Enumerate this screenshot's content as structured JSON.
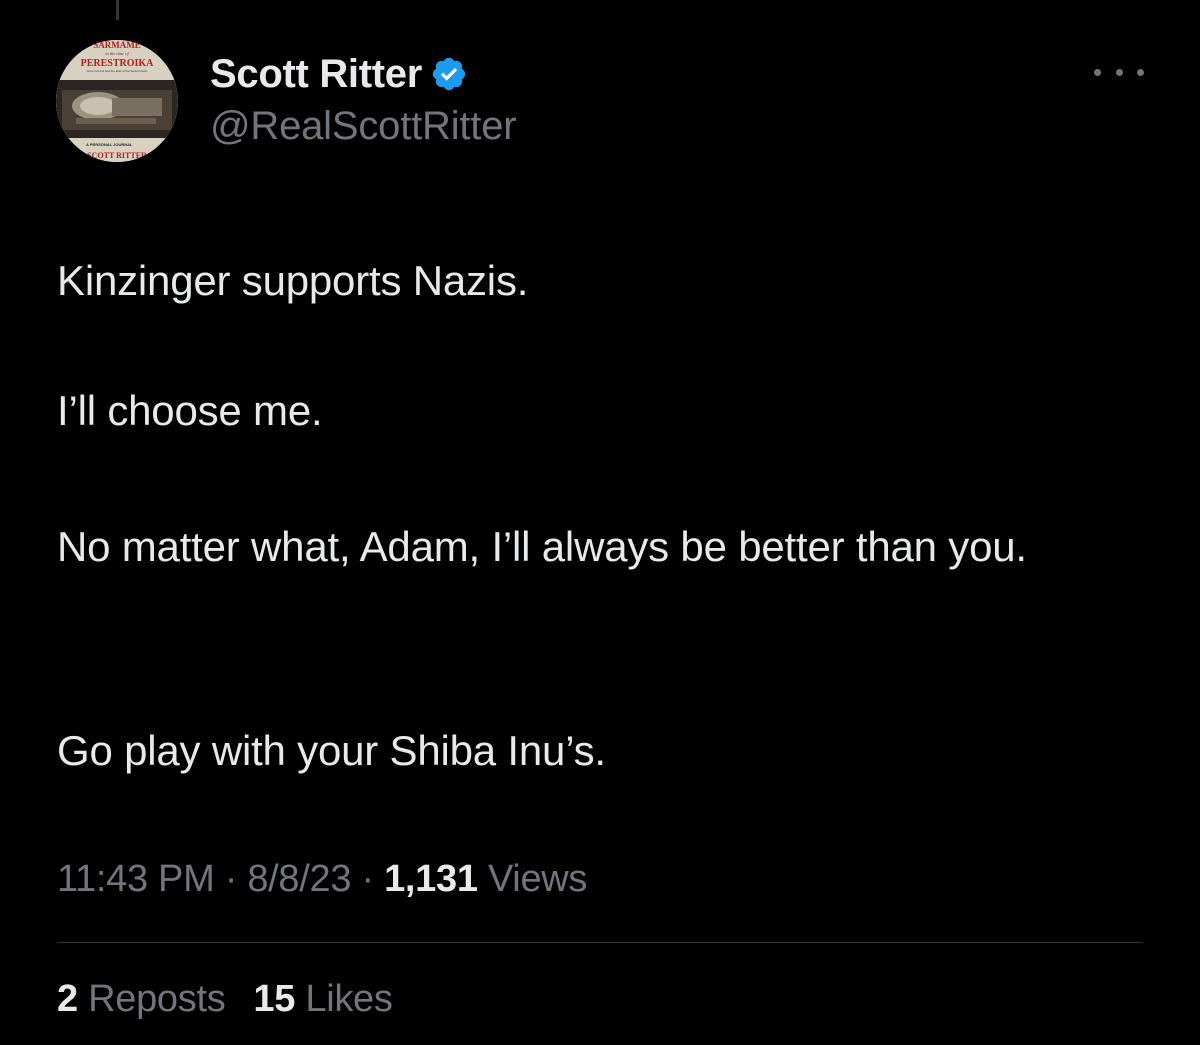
{
  "author": {
    "display_name": "Scott Ritter",
    "handle": "@RealScottRitter",
    "verified_icon": "verified-badge-icon",
    "avatar_text": {
      "title_top": "SARMAME",
      "subtitle": "in the time of",
      "title_main": "PERESTROIKA",
      "tagline": "Arms Control and the End of the Soviet Union",
      "journal": "A PERSONAL JOURNAL",
      "author_name": "SCOTT RITTER"
    }
  },
  "menu_icon": "more-horizontal-icon",
  "tweet": {
    "paragraphs": [
      "Kinzinger supports Nazis.",
      "I’ll choose me.",
      "No matter what, Adam, I’ll always be better than you.",
      "Go play with your Shiba Inu’s."
    ]
  },
  "meta": {
    "time": "11:43 PM",
    "separator": "·",
    "date": "8/8/23",
    "views_count": "1,131",
    "views_label": "Views"
  },
  "stats": {
    "reposts_count": "2",
    "reposts_label": "Reposts",
    "likes_count": "15",
    "likes_label": "Likes"
  },
  "colors": {
    "background": "#000000",
    "primary_text": "#e7e9ea",
    "secondary_text": "#71767b",
    "verified_blue": "#1d9bf0",
    "divider": "#2f3336"
  }
}
